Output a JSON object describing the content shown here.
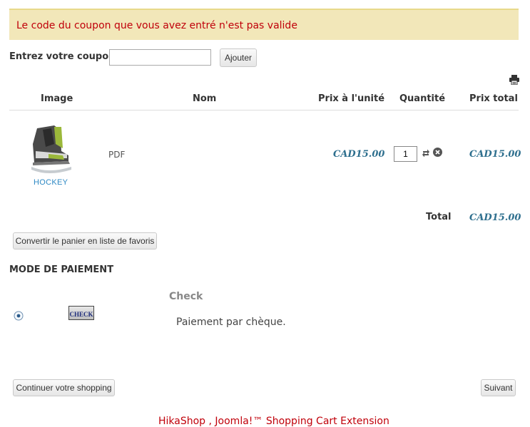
{
  "alert": {
    "message": "Le code du coupon que vous avez entré n'est pas valide"
  },
  "coupon": {
    "label": "Entrez votre coupon",
    "value": "",
    "placeholder": "",
    "add_button": "Ajouter"
  },
  "cart": {
    "columns": {
      "image": "Image",
      "name": "Nom",
      "unit_price": "Prix à l'unité",
      "quantity": "Quantité",
      "total_price": "Prix total"
    },
    "items": [
      {
        "image_caption": "HOCKEY",
        "name": "PDF",
        "unit_price": "CAD15.00",
        "quantity": "1",
        "total_price": "CAD15.00"
      }
    ],
    "total_label": "Total",
    "total_value": "CAD15.00",
    "convert_button": "Convertir le panier en liste de favoris"
  },
  "payment": {
    "section_title": "MODE DE PAIEMENT",
    "methods": [
      {
        "logo_text": "CHECK",
        "name": "Check",
        "description": "Paiement par chèque.",
        "selected": true
      }
    ]
  },
  "navigation": {
    "continue_button": "Continuer votre shopping",
    "next_button": "Suivant"
  },
  "footer": {
    "text": "HikaShop , Joomla!™ Shopping Cart Extension"
  },
  "colors": {
    "alert_bg": "#f2e7b9",
    "alert_text": "#c0000a",
    "price": "#2e6f8e"
  },
  "icons": [
    "print-icon",
    "refresh-icon",
    "remove-icon",
    "radio-icon"
  ]
}
